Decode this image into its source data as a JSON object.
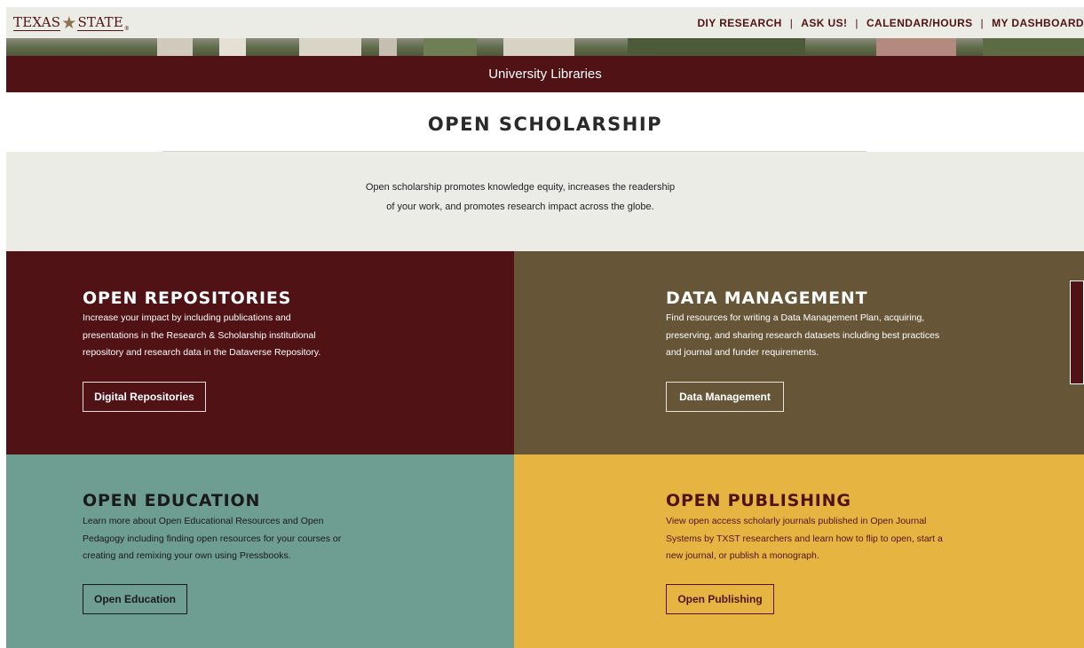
{
  "header": {
    "logo": {
      "word1": "TEXAS",
      "star": "★",
      "word2": "STATE",
      "reg": "®"
    },
    "nav": [
      {
        "label": "DIY RESEARCH"
      },
      {
        "label": "ASK US!"
      },
      {
        "label": "CALENDAR/HOURS"
      },
      {
        "label": "MY DASHBOARD"
      }
    ],
    "separator": "|"
  },
  "brand_bar": {
    "title": "University Libraries"
  },
  "page": {
    "title": "OPEN SCHOLARSHIP",
    "intro_line1": "Open scholarship promotes knowledge equity, increases the readership",
    "intro_line2": "of your work, and promotes research impact across the globe."
  },
  "tiles": {
    "repositories": {
      "heading": "OPEN REPOSITORIES",
      "text": "Increase your impact by including publications and presentations in the Research & Scholarship institutional repository and research data in the Dataverse Repository.",
      "button": "Digital Repositories"
    },
    "data": {
      "heading": "DATA MANAGEMENT",
      "text": "Find resources for writing a Data Management Plan, acquiring, preserving, and sharing research datasets including best practices and journal and funder requirements.",
      "button": "Data Management"
    },
    "education": {
      "heading": "OPEN EDUCATION",
      "text": "Learn more about Open Educational Resources and Open Pedagogy including finding open resources for your courses or creating and remixing your own using Pressbooks.",
      "button": "Open Education"
    },
    "publishing": {
      "heading": "OPEN PUBLISHING",
      "text": "View open access scholarly journals published in Open Journal Systems by TXST researchers and learn how to flip to open, start a new journal, or publish a monograph.",
      "button": "Open Publishing"
    }
  },
  "colors": {
    "maroon": "#501214",
    "gold": "#e6b541",
    "olive_brown": "#665637",
    "teal": "#6e9d91",
    "light_gray": "#ecece6"
  }
}
